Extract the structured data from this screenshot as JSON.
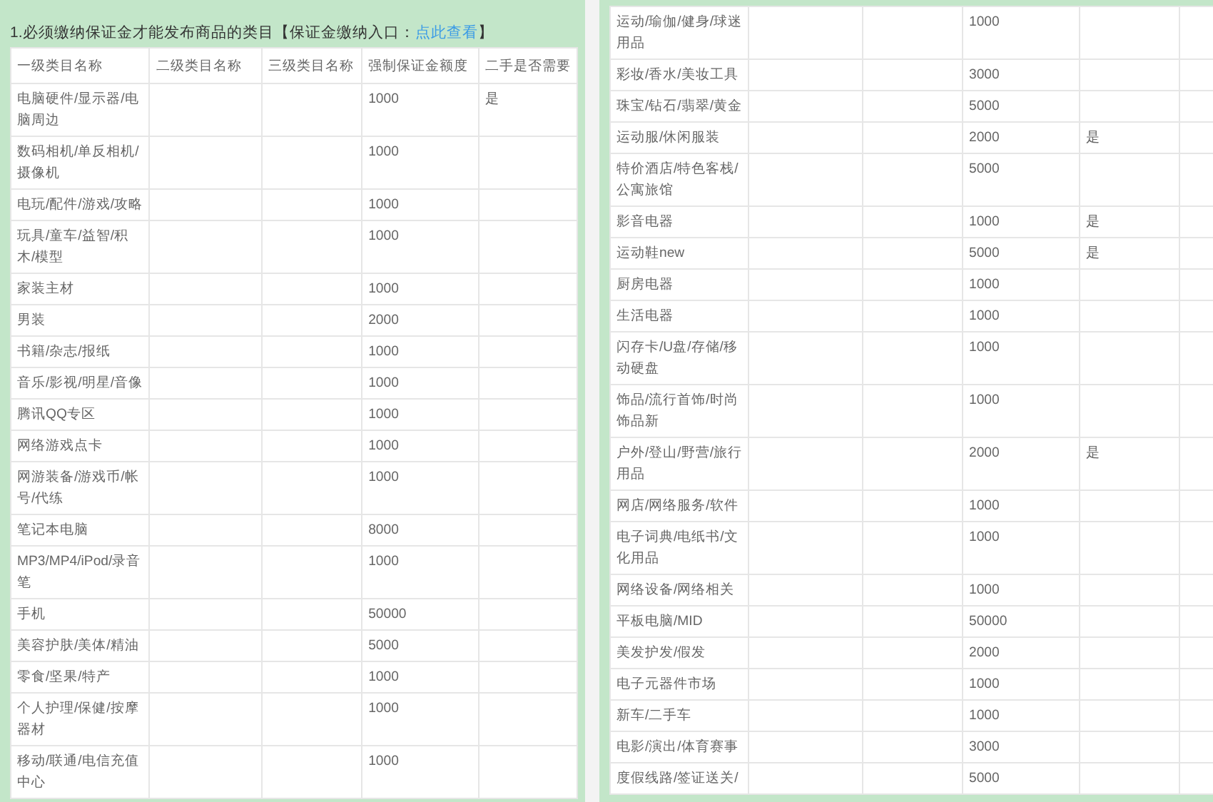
{
  "heading": {
    "text": "1.必须缴纳保证金才能发布商品的类目【保证金缴纳入口：",
    "link": "点此查看",
    "close": "】"
  },
  "left_table": {
    "columns": [
      "一级类目名称",
      "二级类目名称",
      "三级类目名称",
      "强制保证金额度",
      "二手是否需要"
    ],
    "rows": [
      {
        "category": "电脑硬件/显示器/电脑周边",
        "deposit": "1000",
        "second_hand": "是"
      },
      {
        "category": "数码相机/单反相机/摄像机",
        "deposit": "1000"
      },
      {
        "category": "电玩/配件/游戏/攻略",
        "deposit": "1000"
      },
      {
        "category": "玩具/童车/益智/积木/模型",
        "deposit": "1000"
      },
      {
        "category": "家装主材",
        "deposit": "1000"
      },
      {
        "category": "男装",
        "deposit": "2000"
      },
      {
        "category": "书籍/杂志/报纸",
        "deposit": "1000"
      },
      {
        "category": "音乐/影视/明星/音像",
        "deposit": "1000"
      },
      {
        "category": "腾讯QQ专区",
        "deposit": "1000"
      },
      {
        "category": "网络游戏点卡",
        "deposit": "1000"
      },
      {
        "category": "网游装备/游戏币/帐号/代练",
        "deposit": "1000"
      },
      {
        "category": "笔记本电脑",
        "deposit": "8000"
      },
      {
        "category": "MP3/MP4/iPod/录音笔",
        "deposit": "1000"
      },
      {
        "category": "手机",
        "deposit": "50000"
      },
      {
        "category": "美容护肤/美体/精油",
        "deposit": "5000"
      },
      {
        "category": "零食/坚果/特产",
        "deposit": "1000"
      },
      {
        "category": "个人护理/保健/按摩器材",
        "deposit": "1000"
      },
      {
        "category": "移动/联通/电信充值中心",
        "deposit": "1000"
      }
    ]
  },
  "right_table": {
    "rows": [
      {
        "category": "运动/瑜伽/健身/球迷用品",
        "deposit": "1000"
      },
      {
        "category": "彩妆/香水/美妆工具",
        "deposit": "3000"
      },
      {
        "category": "珠宝/钻石/翡翠/黄金",
        "deposit": "5000"
      },
      {
        "category": "运动服/休闲服装",
        "deposit": "2000",
        "second_hand": "是"
      },
      {
        "category": "特价酒店/特色客栈/公寓旅馆",
        "deposit": "5000"
      },
      {
        "category": "影音电器",
        "deposit": "1000",
        "second_hand": "是"
      },
      {
        "category": "运动鞋new",
        "deposit": "5000",
        "second_hand": "是"
      },
      {
        "category": "厨房电器",
        "deposit": "1000"
      },
      {
        "category": "生活电器",
        "deposit": "1000"
      },
      {
        "category": "闪存卡/U盘/存储/移动硬盘",
        "deposit": "1000"
      },
      {
        "category": "饰品/流行首饰/时尚饰品新",
        "deposit": "1000"
      },
      {
        "category": "户外/登山/野营/旅行用品",
        "deposit": "2000",
        "second_hand": "是"
      },
      {
        "category": "网店/网络服务/软件",
        "deposit": "1000"
      },
      {
        "category": "电子词典/电纸书/文化用品",
        "deposit": "1000"
      },
      {
        "category": "网络设备/网络相关",
        "deposit": "1000"
      },
      {
        "category": "平板电脑/MID",
        "deposit": "50000"
      },
      {
        "category": "美发护发/假发",
        "deposit": "2000"
      },
      {
        "category": "电子元器件市场",
        "deposit": "1000"
      },
      {
        "category": "新车/二手车",
        "deposit": "1000"
      },
      {
        "category": "电影/演出/体育赛事",
        "deposit": "3000"
      },
      {
        "category": "度假线路/签证送关/",
        "deposit": "5000"
      }
    ]
  }
}
